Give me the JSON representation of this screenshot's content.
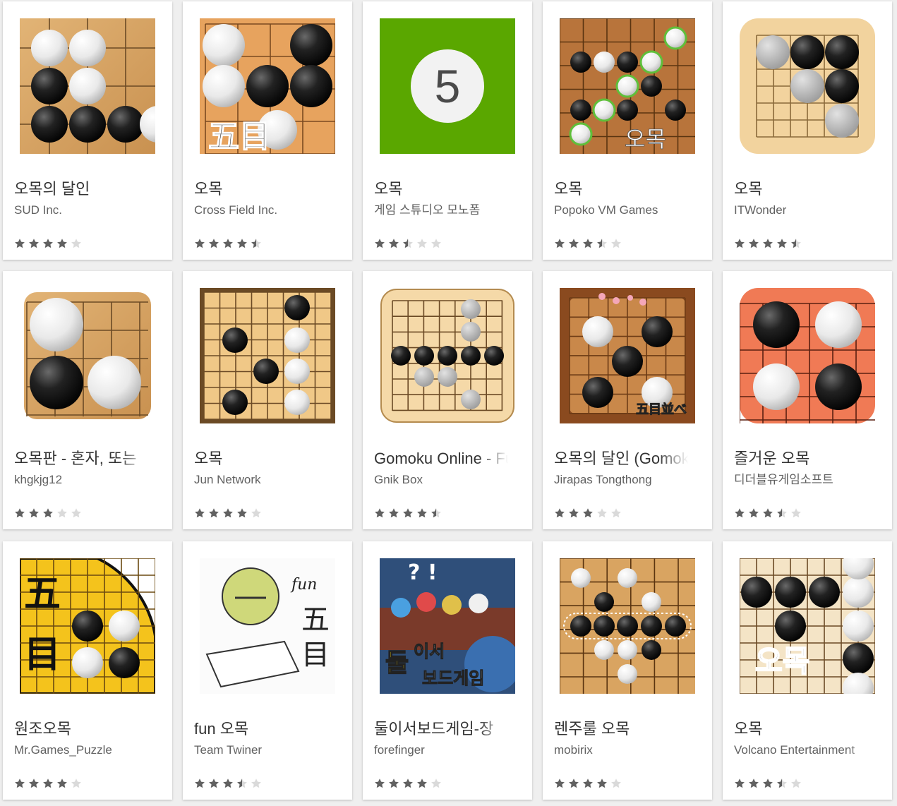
{
  "apps": [
    {
      "title": "오목의 달인",
      "developer": "SUD Inc.",
      "rating": 4.0,
      "icon": "go-board-closeup-icon"
    },
    {
      "title": "오목",
      "developer": "Cross Field Inc.",
      "rating": 4.5,
      "icon": "gomoku-kanji-stones-icon"
    },
    {
      "title": "오목",
      "developer": "게임 스튜디오 모노폼",
      "rating": 2.5,
      "icon": "green-number-five-icon",
      "number": "5"
    },
    {
      "title": "오목",
      "developer": "Popoko VM Games",
      "rating": 3.5,
      "icon": "omok-board-korean-label-icon",
      "label": "오목"
    },
    {
      "title": "오목",
      "developer": "ITWonder",
      "rating": 4.5,
      "icon": "grey-black-stones-icon"
    },
    {
      "title": "오목판 - 혼자, 또는",
      "developer": "khgkjg12",
      "rating": 3.0,
      "icon": "big-stones-board-icon"
    },
    {
      "title": "오목",
      "developer": "Jun Network",
      "rating": 4.0,
      "icon": "framed-go-board-icon"
    },
    {
      "title": "Gomoku Online - Fu",
      "developer": "Gnik Box",
      "rating": 4.5,
      "icon": "stones-row-board-icon"
    },
    {
      "title": "오목의 달인 (Gomok",
      "developer": "Jirapas Tongthong",
      "rating": 3.0,
      "icon": "cherry-blossom-board-icon",
      "label": "五目並べ"
    },
    {
      "title": "즐거운 오목",
      "developer": "디더블유게임소프트",
      "rating": 3.5,
      "icon": "orange-board-four-stones-icon"
    },
    {
      "title": "원조오목",
      "developer": "Mr.Games_Puzzle",
      "rating": 4.0,
      "icon": "yellow-quarter-board-kanji-icon",
      "label": "五目"
    },
    {
      "title": "fun 오목",
      "developer": "Team Twiner",
      "rating": 3.5,
      "icon": "hand-drawn-gomoku-icon",
      "label": "fun 五目"
    },
    {
      "title": "둘이서보드게임-장",
      "developer": "forefinger",
      "rating": 4.0,
      "icon": "board-game-pieces-icon",
      "label": "둘이서 보드게임"
    },
    {
      "title": "렌주룰 오목",
      "developer": "mobirix",
      "rating": 4.0,
      "icon": "renju-board-row-icon"
    },
    {
      "title": "오목",
      "developer": "Volcano Entertainment",
      "rating": 3.5,
      "icon": "cream-board-omok-label-icon",
      "label": "오목"
    }
  ],
  "colors": {
    "star_filled": "#616161",
    "star_empty": "#dadada",
    "title": "#333333",
    "developer": "#616161",
    "page_bg": "#efefef"
  }
}
